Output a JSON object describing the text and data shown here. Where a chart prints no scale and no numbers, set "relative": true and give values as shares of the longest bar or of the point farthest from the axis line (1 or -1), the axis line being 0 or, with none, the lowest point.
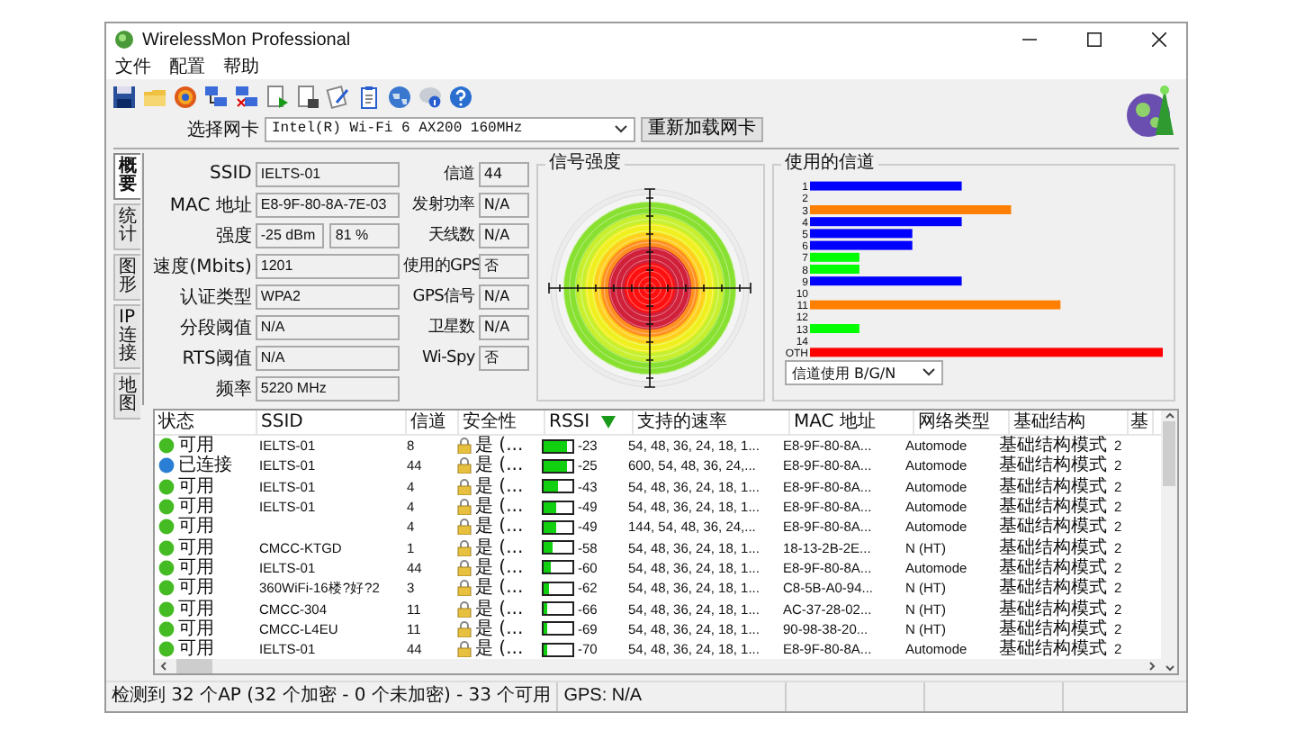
{
  "window": {
    "title": "WirelessMon Professional"
  },
  "menu": [
    "文件",
    "配置",
    "帮助"
  ],
  "adapter": {
    "label": "选择网卡",
    "value": "Intel(R) Wi-Fi 6 AX200 160MHz",
    "reload_button": "重新加载网卡"
  },
  "side_tabs": [
    {
      "label": "概要",
      "selected": true
    },
    {
      "label": "统计",
      "selected": false
    },
    {
      "label": "图形",
      "selected": false
    },
    {
      "label": "IP连接",
      "selected": false
    },
    {
      "label": "地图",
      "selected": false
    }
  ],
  "summary": {
    "left": [
      {
        "label": "SSID",
        "values": [
          "IELTS-01"
        ]
      },
      {
        "label": "MAC 地址",
        "values": [
          "E8-9F-80-8A-7E-03"
        ]
      },
      {
        "label": "强度",
        "values": [
          "-25 dBm",
          "81 %"
        ]
      },
      {
        "label": "速度(Mbits)",
        "values": [
          "1201"
        ]
      },
      {
        "label": "认证类型",
        "values": [
          "WPA2"
        ]
      },
      {
        "label": "分段阈值",
        "values": [
          "N/A"
        ]
      },
      {
        "label": "RTS阈值",
        "values": [
          "N/A"
        ]
      },
      {
        "label": "频率",
        "values": [
          "5220 MHz"
        ]
      }
    ],
    "right": [
      {
        "label": "信道",
        "value": "44"
      },
      {
        "label": "发射功率",
        "value": "N/A"
      },
      {
        "label": "天线数",
        "value": "N/A"
      },
      {
        "label": "使用的GPS",
        "value": "否"
      },
      {
        "label": "GPS信号",
        "value": "N/A"
      },
      {
        "label": "卫星数",
        "value": "N/A"
      },
      {
        "label": "Wi-Spy",
        "value": "否"
      }
    ]
  },
  "signal_panel": {
    "title": "信号强度"
  },
  "channel_panel": {
    "title": "使用的信道",
    "filter": "信道使用 B/G/N",
    "chart_data": {
      "type": "bar",
      "orientation": "horizontal",
      "relative": true,
      "categories": [
        "1",
        "2",
        "3",
        "4",
        "5",
        "6",
        "7",
        "8",
        "9",
        "10",
        "11",
        "12",
        "13",
        "14",
        "OTH"
      ],
      "series": [
        {
          "color": "#0000ff",
          "values": [
            0.43,
            null,
            null,
            0.43,
            0.29,
            0.29,
            null,
            null,
            0.43,
            null,
            null,
            null,
            null,
            null,
            null
          ]
        },
        {
          "color": "#ff8000",
          "values": [
            null,
            null,
            0.57,
            null,
            null,
            null,
            null,
            null,
            null,
            null,
            0.71,
            null,
            null,
            null,
            null
          ]
        },
        {
          "color": "#00ff00",
          "values": [
            null,
            null,
            null,
            null,
            null,
            null,
            0.14,
            0.14,
            null,
            null,
            null,
            null,
            0.14,
            null,
            null
          ]
        },
        {
          "color": "#ff0000",
          "values": [
            null,
            null,
            null,
            null,
            null,
            null,
            null,
            null,
            null,
            null,
            null,
            null,
            null,
            null,
            1
          ]
        }
      ]
    }
  },
  "table": {
    "columns": [
      "状态",
      "SSID",
      "信道",
      "安全性",
      "RSSI",
      "支持的速率",
      "MAC 地址",
      "网络类型",
      "基础结构",
      "基"
    ],
    "rows": [
      {
        "status": "可用",
        "color": "#44bb22",
        "ssid": "IELTS-01",
        "channel": "8",
        "security": "是 (...",
        "rssi": "-23",
        "level": 0.8,
        "rates": "54, 48, 36, 24, 18, 1...",
        "mac": "E8-9F-80-8A...",
        "type": "Automode",
        "infra": "基础结构模式",
        "column_10": "2"
      },
      {
        "status": "已连接",
        "color": "#2a7fd4",
        "ssid": "IELTS-01",
        "channel": "44",
        "security": "是 (...",
        "rssi": "-25",
        "level": 0.8,
        "rates": "600, 54, 48, 36, 24,...",
        "mac": "E8-9F-80-8A...",
        "type": "Automode",
        "infra": "基础结构模式",
        "column_10": "2"
      },
      {
        "status": "可用",
        "color": "#44bb22",
        "ssid": "IELTS-01",
        "channel": "4",
        "security": "是 (...",
        "rssi": "-43",
        "level": 0.5,
        "rates": "54, 48, 36, 24, 18, 1...",
        "mac": "E8-9F-80-8A...",
        "type": "Automode",
        "infra": "基础结构模式",
        "column_10": "2"
      },
      {
        "status": "可用",
        "color": "#44bb22",
        "ssid": "IELTS-01",
        "channel": "4",
        "security": "是 (...",
        "rssi": "-49",
        "level": 0.45,
        "rates": "54, 48, 36, 24, 18, 1...",
        "mac": "E8-9F-80-8A...",
        "type": "Automode",
        "infra": "基础结构模式",
        "column_10": "2"
      },
      {
        "status": "可用",
        "color": "#44bb22",
        "ssid": "",
        "channel": "4",
        "security": "是 (...",
        "rssi": "-49",
        "level": 0.45,
        "rates": "144, 54, 48, 36, 24,...",
        "mac": "E8-9F-80-8A...",
        "type": "Automode",
        "infra": "基础结构模式",
        "column_10": "2"
      },
      {
        "status": "可用",
        "color": "#44bb22",
        "ssid": "CMCC-KTGD",
        "channel": "1",
        "security": "是 (...",
        "rssi": "-58",
        "level": 0.3,
        "rates": "54, 48, 36, 24, 18, 1...",
        "mac": "18-13-2B-2E...",
        "type": "N (HT)",
        "infra": "基础结构模式",
        "column_10": "2"
      },
      {
        "status": "可用",
        "color": "#44bb22",
        "ssid": "IELTS-01",
        "channel": "44",
        "security": "是 (...",
        "rssi": "-60",
        "level": 0.25,
        "rates": "54, 48, 36, 24, 18, 1...",
        "mac": "E8-9F-80-8A...",
        "type": "Automode",
        "infra": "基础结构模式",
        "column_10": "2"
      },
      {
        "status": "可用",
        "color": "#44bb22",
        "ssid": "360WiFi-16楼?好?2",
        "channel": "3",
        "security": "是 (...",
        "rssi": "-62",
        "level": 0.2,
        "rates": "54, 48, 36, 24, 18, 1...",
        "mac": "C8-5B-A0-94...",
        "type": "N (HT)",
        "infra": "基础结构模式",
        "column_10": "2"
      },
      {
        "status": "可用",
        "color": "#44bb22",
        "ssid": "CMCC-304",
        "channel": "11",
        "security": "是 (...",
        "rssi": "-66",
        "level": 0.15,
        "rates": "54, 48, 36, 24, 18, 1...",
        "mac": "AC-37-28-02...",
        "type": "N (HT)",
        "infra": "基础结构模式",
        "column_10": "2"
      },
      {
        "status": "可用",
        "color": "#44bb22",
        "ssid": "CMCC-L4EU",
        "channel": "11",
        "security": "是 (...",
        "rssi": "-69",
        "level": 0.12,
        "rates": "54, 48, 36, 24, 18, 1...",
        "mac": "90-98-38-20...",
        "type": "N (HT)",
        "infra": "基础结构模式",
        "column_10": "2"
      },
      {
        "status": "可用",
        "color": "#44bb22",
        "ssid": "IELTS-01",
        "channel": "44",
        "security": "是 (...",
        "rssi": "-70",
        "level": 0.1,
        "rates": "54, 48, 36, 24, 18, 1...",
        "mac": "E8-9F-80-8A...",
        "type": "Automode",
        "infra": "基础结构模式",
        "column_10": "2"
      }
    ]
  },
  "status_bar": [
    "检测到 32 个AP (32 个加密 - 0 个未加密) - 33 个可用",
    "GPS: N/A"
  ]
}
